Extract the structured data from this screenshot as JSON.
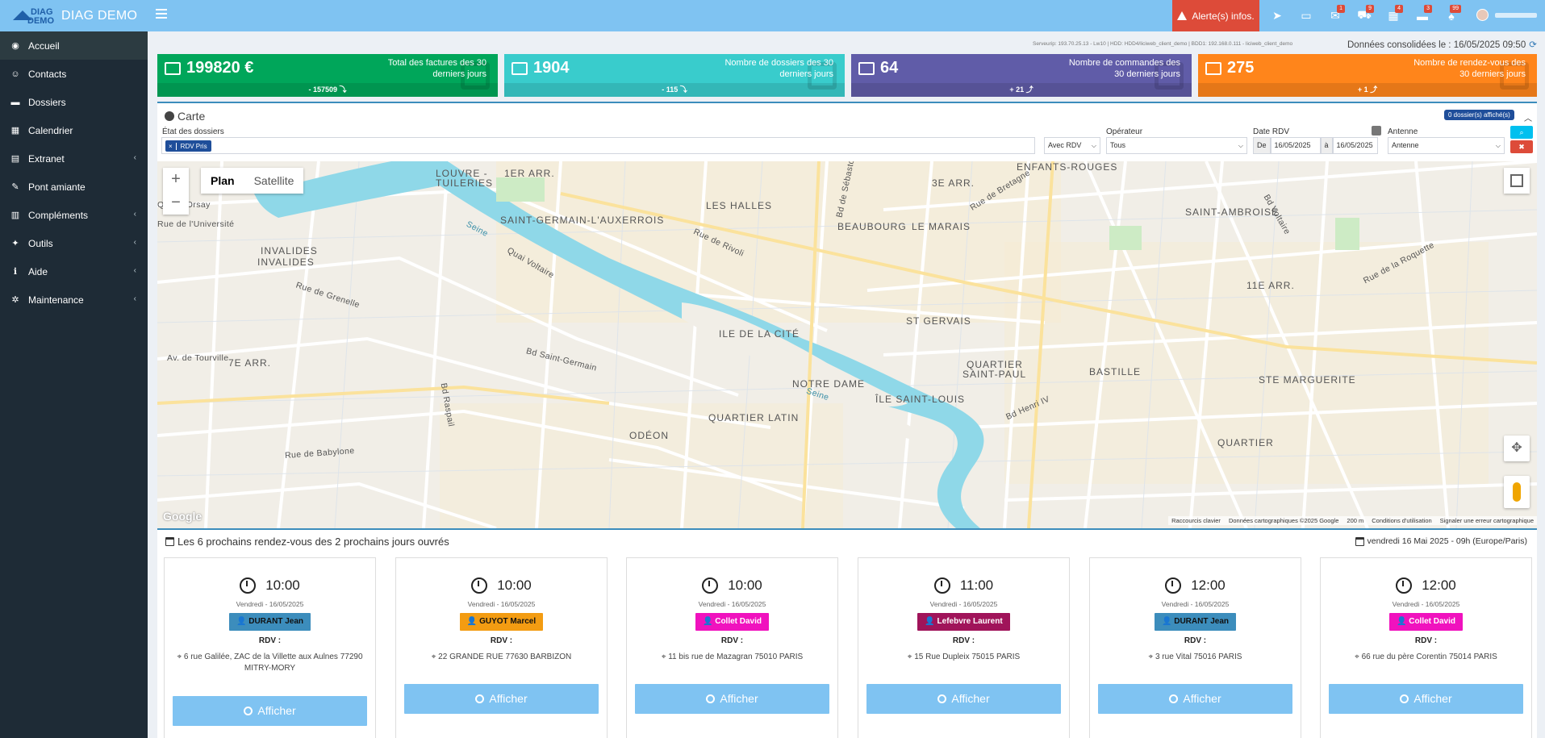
{
  "app": {
    "logo_top": "DIAG",
    "logo_bottom": "DEMO",
    "name": "DIAG DEMO"
  },
  "topbar": {
    "alert_label": "Alerte(s) infos.",
    "badges": [
      "1",
      "9",
      "4",
      "3",
      "99"
    ]
  },
  "sidebar": {
    "items": [
      {
        "label": "Accueil",
        "icon": "dashboard-icon",
        "glyph": "◉"
      },
      {
        "label": "Contacts",
        "icon": "user-icon",
        "glyph": "👤"
      },
      {
        "label": "Dossiers",
        "icon": "folder-icon",
        "glyph": "▬"
      },
      {
        "label": "Calendrier",
        "icon": "calendar-icon",
        "glyph": "▦"
      },
      {
        "label": "Extranet",
        "icon": "file-icon",
        "glyph": "▤"
      },
      {
        "label": "Pont amiante",
        "icon": "wrench-brush-icon",
        "glyph": "✎"
      },
      {
        "label": "Compléments",
        "icon": "bar-chart-icon",
        "glyph": "▥"
      },
      {
        "label": "Outils",
        "icon": "wrench-icon",
        "glyph": "✦"
      },
      {
        "label": "Aide",
        "icon": "info-icon",
        "glyph": "ℹ"
      },
      {
        "label": "Maintenance",
        "icon": "cog-icon",
        "glyph": "✲"
      }
    ]
  },
  "server_info": "Serveurip: 193.70.25.13 - Lw10 | HDD: HDD4/liciweb_client_demo | BDD1: 192.168.0.111 - liciweb_client_demo",
  "consolidated": "Données consolidées le : 16/05/2025 09:50",
  "stats": [
    {
      "value": "199820 €",
      "label": "Total des factures des 30 derniers jours",
      "delta": "- 157509",
      "color": "#00a65a"
    },
    {
      "value": "1904",
      "label": "Nombre de dossiers des 30 derniers jours",
      "delta": "- 115",
      "color": "#39cccc"
    },
    {
      "value": "64",
      "label": "Nombre de commandes des 30 derniers jours",
      "delta": "+ 21",
      "color": "#605ca8"
    },
    {
      "value": "275",
      "label": "Nombre de rendez-vous des 30 derniers jours",
      "delta": "+ 1",
      "color": "#ff851b"
    }
  ],
  "map_card": {
    "title": "Carte",
    "shown_badge": "0 dossier(s) affiché(s)",
    "etat_label": "État des dossiers",
    "etat_tag": "RDV Pris",
    "avec_rdv": "Avec RDV",
    "operateur_label": "Opérateur",
    "operateur_value": "Tous",
    "date_label": "Date RDV",
    "date_from_prefix": "De",
    "date_from": "16/05/2025",
    "date_to_prefix": "à",
    "date_to": "16/05/2025",
    "antenne_label": "Antenne",
    "antenne_value": "Antenne"
  },
  "map": {
    "type_plan": "Plan",
    "type_satellite": "Satellite",
    "google": "Google",
    "attribution": [
      "Raccourcis clavier",
      "Données cartographiques ©2025 Google",
      "200 m",
      "Conditions d'utilisation",
      "Signaler une erreur cartographique"
    ],
    "labels": {
      "louvre": "LOUVRE -",
      "tuileries": "TUILERIES",
      "arr1": "1ER ARR.",
      "arr3": "3E ARR.",
      "arr7": "7E ARR.",
      "arr11": "11E ARR.",
      "saint_germain": "SAINT-GERMAIN-L'AUXERROIS",
      "halles": "LES HALLES",
      "beaubourg": "BEAUBOURG",
      "marais": "LE MARAIS",
      "enfants": "ENFANTS-ROUGES",
      "ambroise": "SAINT-AMBROISE",
      "invalides1": "INVALIDES",
      "invalides2": "INVALIDES",
      "ile_cite": "ILE DE LA CITÉ",
      "st_gervais": "ST GERVAIS",
      "notre_dame": "NOTRE DAME",
      "ile_st_louis": "ÎLE SAINT-LOUIS",
      "st_paul1": "QUARTIER",
      "st_paul2": "SAINT-PAUL",
      "bastille": "BASTILLE",
      "marguerite": "STE MARGUERITE",
      "latin": "QUARTIER LATIN",
      "odeon": "ODÉON",
      "quartier": "QUARTIER",
      "seine1": "Seine",
      "seine2": "Seine",
      "rivoli": "Rue de Rivoli",
      "quai_voltaire": "Quai Voltaire",
      "grenelle": "Rue de Grenelle",
      "bd_st_germain": "Bd Saint-Germain",
      "bd_voltaire": "Bd Voltaire",
      "rue_roquette": "Rue de la Roquette",
      "bd_raspail": "Bd Raspail",
      "bd_sebastopol": "Bd de Sébastopol",
      "quai_orsay": "Quai d'Orsay",
      "univ": "Rue de l'Université",
      "babylone": "Rue de Babylone",
      "tourville": "Av. de Tourville",
      "bd_henri": "Bd Henri IV",
      "bretagne": "Rue de Bretagne"
    }
  },
  "rdv": {
    "title": "Les 6 prochains rendez-vous des 2 prochains jours ouvrés",
    "date": "vendredi 16 Mai 2025 - 09h (Europe/Paris)",
    "rdv_label": "RDV :",
    "button_label": "Afficher",
    "cards": [
      {
        "time": "10:00",
        "date": "Vendredi - 16/05/2025",
        "who": "DURANT Jean",
        "color": "#3c8dbc",
        "address": "6 rue Galilée, ZAC de la Villette aux Aulnes 77290 MITRY-MORY"
      },
      {
        "time": "10:00",
        "date": "Vendredi - 16/05/2025",
        "who": "GUYOT Marcel",
        "color": "#f39c12",
        "address": "22 GRANDE RUE 77630 BARBIZON"
      },
      {
        "time": "10:00",
        "date": "Vendredi - 16/05/2025",
        "who": "Collet David",
        "color": "#f012be",
        "address": "11 bis rue de Mazagran 75010 PARIS"
      },
      {
        "time": "11:00",
        "date": "Vendredi - 16/05/2025",
        "who": "Lefebvre Laurent",
        "color": "#a0145a",
        "address": "15 Rue Dupleix 75015 PARIS"
      },
      {
        "time": "12:00",
        "date": "Vendredi - 16/05/2025",
        "who": "DURANT Jean",
        "color": "#3c8dbc",
        "address": "3 rue Vital 75016 PARIS"
      },
      {
        "time": "12:00",
        "date": "Vendredi - 16/05/2025",
        "who": "Collet David",
        "color": "#f012be",
        "address": "66 rue du père Corentin 75014 PARIS"
      }
    ]
  }
}
